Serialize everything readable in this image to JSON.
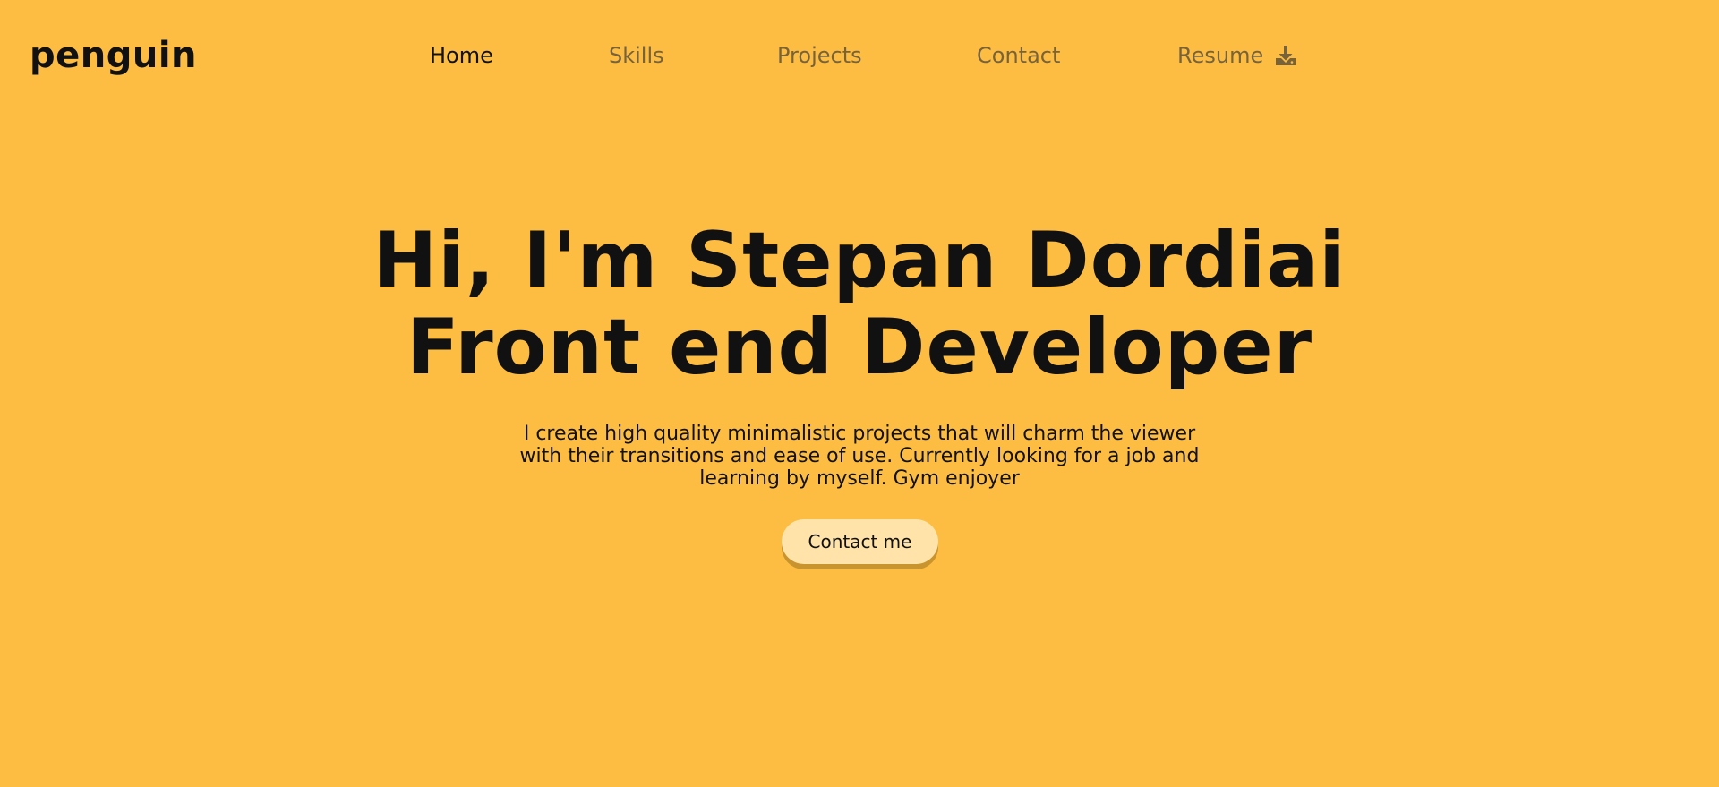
{
  "logo": {
    "text": "penguin"
  },
  "nav": {
    "items": [
      {
        "label": "Home",
        "active": true
      },
      {
        "label": "Skills",
        "active": false
      },
      {
        "label": "Projects",
        "active": false
      },
      {
        "label": "Contact",
        "active": false
      },
      {
        "label": "Resume",
        "active": false,
        "icon": "download-icon"
      }
    ]
  },
  "hero": {
    "title_line1": "Hi, I'm Stepan Dordiai",
    "title_line2": "Front end Developer",
    "description": "I create high quality minimalistic projects that will charm the viewer with their transitions and ease of use. Currently looking for a job and learning by myself. Gym enjoyer",
    "cta_label": "Contact me"
  },
  "colors": {
    "background": "#fdbd43",
    "text": "#111111",
    "nav_inactive": "#77623a",
    "button_bg": "#ffe3a8",
    "button_shadow": "#c9932d"
  }
}
